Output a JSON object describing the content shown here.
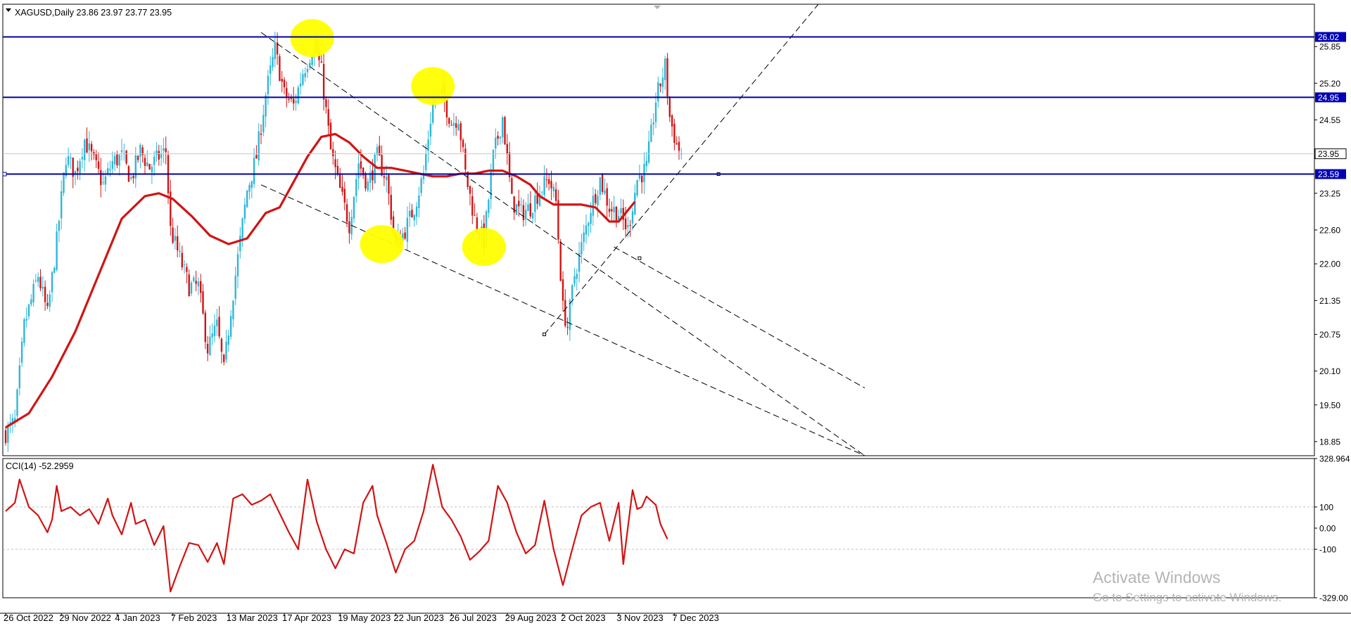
{
  "window": {
    "symbol_header": "XAGUSD,Daily  23.86 23.97 23.77 23.95",
    "indicator_header": "CCI(14) -52.2959"
  },
  "watermark": {
    "line1": "Activate Windows",
    "line2": "Go to Settings to activate Windows."
  },
  "colors": {
    "bull_candle": "#2eb6d8",
    "bear_candle": "#d11414",
    "ma_line": "#d11414",
    "cci_line": "#d11414",
    "hline": "#0000a0",
    "tag_bg": "#0000b4",
    "highlight": "#ffff00"
  },
  "chart_data": [
    {
      "type": "candlestick",
      "symbol": "XAGUSD",
      "timeframe": "Daily",
      "ylim": [
        18.6,
        26.6
      ],
      "y_ticks": [
        "25.85",
        "25.20",
        "24.55",
        "23.25",
        "22.60",
        "22.00",
        "21.35",
        "20.75",
        "20.10",
        "19.50",
        "18.85"
      ],
      "y_tick_values": [
        25.85,
        25.2,
        24.55,
        23.25,
        22.6,
        22.0,
        21.35,
        20.75,
        20.1,
        19.5,
        18.85
      ],
      "x_labels": [
        "26 Oct 2022",
        "29 Nov 2022",
        "4 Jan 2023",
        "7 Feb 2023",
        "13 Mar 2023",
        "17 Apr 2023",
        "19 May 2023",
        "22 Jun 2023",
        "26 Jul 2023",
        "29 Aug 2023",
        "2 Oct 2023",
        "3 Nov 2023",
        "7 Dec 2023"
      ],
      "x_label_index": [
        0,
        24,
        48,
        72,
        96,
        120,
        144,
        168,
        192,
        216,
        240,
        264,
        288
      ],
      "bar_count": 292,
      "price_path": [
        [
          0,
          19.0
        ],
        [
          4,
          19.2
        ],
        [
          8,
          20.9
        ],
        [
          14,
          21.8
        ],
        [
          18,
          21.1
        ],
        [
          22,
          22.4
        ],
        [
          26,
          23.9
        ],
        [
          30,
          23.6
        ],
        [
          34,
          24.2
        ],
        [
          38,
          23.8
        ],
        [
          42,
          23.4
        ],
        [
          46,
          23.8
        ],
        [
          50,
          23.9
        ],
        [
          54,
          23.5
        ],
        [
          58,
          24.0
        ],
        [
          62,
          23.7
        ],
        [
          66,
          23.9
        ],
        [
          69,
          24.0
        ],
        [
          71,
          22.6
        ],
        [
          75,
          22.1
        ],
        [
          79,
          21.6
        ],
        [
          83,
          21.6
        ],
        [
          87,
          20.5
        ],
        [
          91,
          20.9
        ],
        [
          94,
          20.1
        ],
        [
          97,
          21.2
        ],
        [
          100,
          22.1
        ],
        [
          104,
          23.3
        ],
        [
          108,
          23.9
        ],
        [
          112,
          25.0
        ],
        [
          116,
          25.8
        ],
        [
          120,
          25.0
        ],
        [
          124,
          24.8
        ],
        [
          128,
          25.4
        ],
        [
          133,
          25.9
        ],
        [
          136,
          25.4
        ],
        [
          140,
          24.0
        ],
        [
          144,
          23.3
        ],
        [
          148,
          22.7
        ],
        [
          152,
          23.8
        ],
        [
          156,
          23.4
        ],
        [
          160,
          23.9
        ],
        [
          164,
          23.5
        ],
        [
          168,
          22.3
        ],
        [
          172,
          22.6
        ],
        [
          176,
          23.0
        ],
        [
          180,
          23.6
        ],
        [
          184,
          24.9
        ],
        [
          188,
          25.0
        ],
        [
          192,
          24.5
        ],
        [
          195,
          24.6
        ],
        [
          198,
          23.6
        ],
        [
          202,
          22.8
        ],
        [
          206,
          22.4
        ],
        [
          210,
          23.9
        ],
        [
          214,
          24.6
        ],
        [
          218,
          23.1
        ],
        [
          222,
          22.9
        ],
        [
          226,
          23.0
        ],
        [
          230,
          23.3
        ],
        [
          234,
          23.5
        ],
        [
          237,
          23.1
        ],
        [
          240,
          21.2
        ],
        [
          242,
          20.9
        ],
        [
          245,
          21.8
        ],
        [
          248,
          22.3
        ],
        [
          252,
          23.0
        ],
        [
          256,
          23.5
        ],
        [
          260,
          23.0
        ],
        [
          264,
          22.9
        ],
        [
          268,
          22.6
        ],
        [
          272,
          23.5
        ],
        [
          276,
          23.7
        ],
        [
          280,
          24.9
        ],
        [
          284,
          25.5
        ],
        [
          286,
          24.6
        ],
        [
          289,
          24.1
        ],
        [
          291,
          23.95
        ]
      ],
      "ma_path": [
        [
          0,
          19.1
        ],
        [
          10,
          19.35
        ],
        [
          20,
          20.0
        ],
        [
          30,
          20.8
        ],
        [
          40,
          21.8
        ],
        [
          50,
          22.8
        ],
        [
          60,
          23.2
        ],
        [
          66,
          23.25
        ],
        [
          72,
          23.15
        ],
        [
          80,
          22.85
        ],
        [
          88,
          22.5
        ],
        [
          96,
          22.35
        ],
        [
          104,
          22.45
        ],
        [
          112,
          22.9
        ],
        [
          118,
          23.0
        ],
        [
          124,
          23.45
        ],
        [
          130,
          23.9
        ],
        [
          136,
          24.25
        ],
        [
          142,
          24.3
        ],
        [
          148,
          24.15
        ],
        [
          154,
          23.9
        ],
        [
          160,
          23.7
        ],
        [
          166,
          23.7
        ],
        [
          172,
          23.65
        ],
        [
          178,
          23.6
        ],
        [
          184,
          23.55
        ],
        [
          190,
          23.55
        ],
        [
          196,
          23.6
        ],
        [
          202,
          23.6
        ],
        [
          208,
          23.65
        ],
        [
          214,
          23.65
        ],
        [
          220,
          23.55
        ],
        [
          226,
          23.4
        ],
        [
          230,
          23.2
        ],
        [
          236,
          23.05
        ],
        [
          242,
          23.05
        ],
        [
          248,
          23.05
        ],
        [
          254,
          23.0
        ],
        [
          260,
          22.75
        ],
        [
          264,
          22.75
        ],
        [
          268,
          22.95
        ],
        [
          271,
          23.1
        ]
      ],
      "horizontal_levels": [
        {
          "price": 26.02,
          "label": "26.02",
          "tag": true
        },
        {
          "price": 24.95,
          "label": "24.95",
          "tag": true
        },
        {
          "price": 23.59,
          "label": "23.59",
          "tag": true
        },
        {
          "price": 23.95,
          "label": "23.95",
          "tag": true,
          "style": "current"
        }
      ],
      "trendlines": [
        {
          "style": "dashed",
          "from": [
            110,
            26.1
          ],
          "to": [
            370,
            18.6
          ]
        },
        {
          "style": "dashed",
          "from": [
            110,
            23.4
          ],
          "to": [
            370,
            18.6
          ]
        },
        {
          "style": "dashed",
          "from": [
            232,
            20.75
          ],
          "to": [
            350,
            26.6
          ]
        },
        {
          "style": "dashed",
          "from": [
            262,
            22.3
          ],
          "to": [
            370,
            19.8
          ]
        }
      ],
      "highlight_markers": [
        {
          "x": 132,
          "y": 26.0
        },
        {
          "x": 184,
          "y": 25.15
        },
        {
          "x": 162,
          "y": 22.35
        },
        {
          "x": 206,
          "y": 22.3
        }
      ]
    },
    {
      "type": "line",
      "name": "CCI(14)",
      "ylim": [
        -329.0,
        328.964
      ],
      "y_ticks": [
        "328.964",
        "100",
        "0.00",
        "-100",
        "-329.00"
      ],
      "y_tick_values": [
        328.964,
        100,
        0,
        -100,
        -329.0
      ],
      "reference_levels": [
        100,
        -100
      ],
      "points": [
        [
          0,
          80
        ],
        [
          4,
          120
        ],
        [
          6,
          230
        ],
        [
          10,
          100
        ],
        [
          14,
          60
        ],
        [
          18,
          -20
        ],
        [
          20,
          40
        ],
        [
          22,
          200
        ],
        [
          24,
          80
        ],
        [
          28,
          100
        ],
        [
          32,
          60
        ],
        [
          36,
          90
        ],
        [
          40,
          20
        ],
        [
          44,
          140
        ],
        [
          46,
          60
        ],
        [
          50,
          -30
        ],
        [
          54,
          120
        ],
        [
          56,
          20
        ],
        [
          60,
          40
        ],
        [
          64,
          -80
        ],
        [
          68,
          10
        ],
        [
          71,
          -300
        ],
        [
          75,
          -180
        ],
        [
          79,
          -70
        ],
        [
          83,
          -80
        ],
        [
          87,
          -160
        ],
        [
          91,
          -70
        ],
        [
          94,
          -170
        ],
        [
          98,
          140
        ],
        [
          102,
          160
        ],
        [
          106,
          110
        ],
        [
          110,
          130
        ],
        [
          114,
          160
        ],
        [
          118,
          70
        ],
        [
          122,
          -20
        ],
        [
          126,
          -100
        ],
        [
          130,
          230
        ],
        [
          134,
          30
        ],
        [
          138,
          -100
        ],
        [
          142,
          -190
        ],
        [
          146,
          -100
        ],
        [
          150,
          -120
        ],
        [
          154,
          120
        ],
        [
          158,
          200
        ],
        [
          160,
          60
        ],
        [
          164,
          -70
        ],
        [
          168,
          -210
        ],
        [
          172,
          -100
        ],
        [
          176,
          -60
        ],
        [
          180,
          80
        ],
        [
          184,
          300
        ],
        [
          188,
          100
        ],
        [
          192,
          40
        ],
        [
          196,
          -40
        ],
        [
          200,
          -150
        ],
        [
          204,
          -110
        ],
        [
          208,
          -60
        ],
        [
          212,
          200
        ],
        [
          216,
          120
        ],
        [
          220,
          -20
        ],
        [
          224,
          -120
        ],
        [
          228,
          -80
        ],
        [
          232,
          130
        ],
        [
          236,
          -100
        ],
        [
          240,
          -270
        ],
        [
          244,
          -100
        ],
        [
          248,
          60
        ],
        [
          252,
          100
        ],
        [
          256,
          120
        ],
        [
          260,
          -60
        ],
        [
          264,
          120
        ],
        [
          266,
          -170
        ],
        [
          270,
          180
        ],
        [
          272,
          90
        ],
        [
          274,
          100
        ],
        [
          276,
          150
        ],
        [
          280,
          110
        ],
        [
          282,
          20
        ],
        [
          285,
          -52
        ]
      ]
    }
  ]
}
